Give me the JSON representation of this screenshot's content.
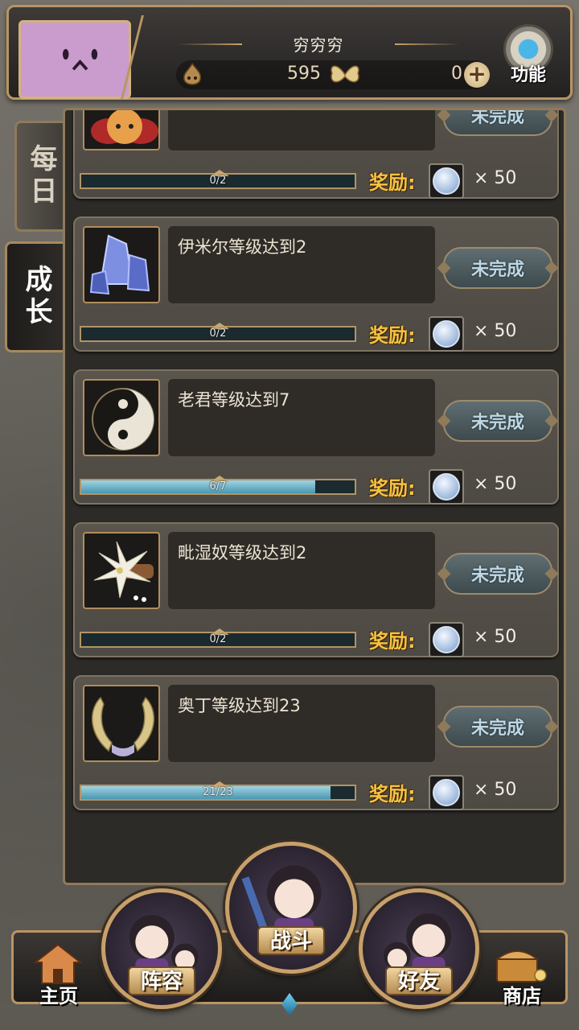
{
  "header": {
    "username": "穷穷穷",
    "gold": "595",
    "gems": "0",
    "function_label": "功能"
  },
  "tabs": {
    "daily": "每日",
    "growth": "成长"
  },
  "quests": [
    {
      "title": "",
      "progress_text": "0/2",
      "progress": 0.0,
      "status": "未完成",
      "reward_label": "奖励:",
      "reward_qty": "× 50",
      "icon": "flower-creature-icon"
    },
    {
      "title": "伊米尔等级达到2",
      "progress_text": "0/2",
      "progress": 0.0,
      "status": "未完成",
      "reward_label": "奖励:",
      "reward_qty": "× 50",
      "icon": "ice-crystal-icon"
    },
    {
      "title": "老君等级达到7",
      "progress_text": "6/7",
      "progress": 0.857,
      "status": "未完成",
      "reward_label": "奖励:",
      "reward_qty": "× 50",
      "icon": "yin-yang-icon"
    },
    {
      "title": "毗湿奴等级达到2",
      "progress_text": "0/2",
      "progress": 0.0,
      "status": "未完成",
      "reward_label": "奖励:",
      "reward_qty": "× 50",
      "icon": "lotus-icon"
    },
    {
      "title": "奥丁等级达到23",
      "progress_text": "21/23",
      "progress": 0.913,
      "status": "未完成",
      "reward_label": "奖励:",
      "reward_qty": "× 50",
      "icon": "golden-wings-icon"
    }
  ],
  "nav": {
    "home": "主页",
    "team": "阵容",
    "battle": "战斗",
    "friends": "好友",
    "shop": "商店"
  },
  "colors": {
    "frame_gold": "#b99563",
    "reward_yellow": "#f6c244",
    "progress_blue": "#4a97b0"
  }
}
